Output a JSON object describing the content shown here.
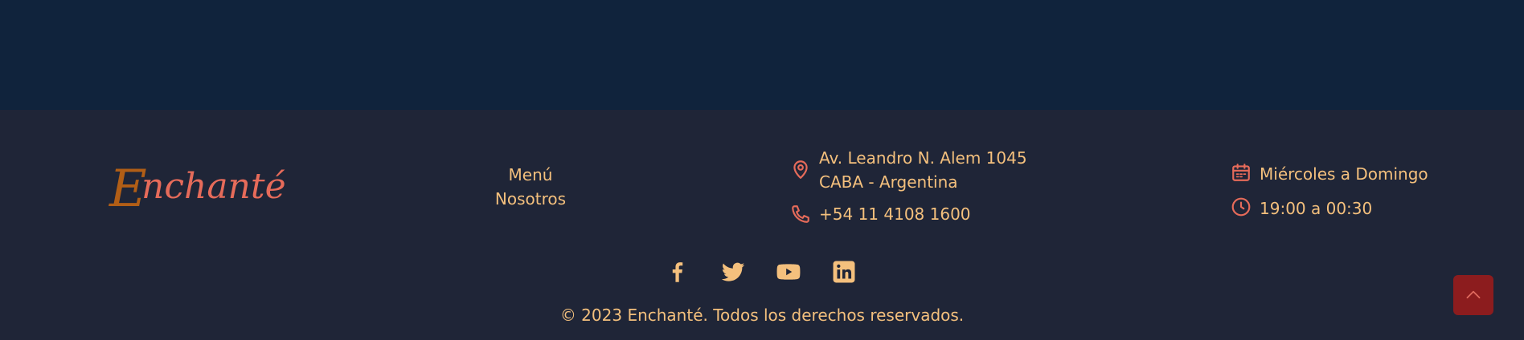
{
  "brand": {
    "logo_first": "E",
    "logo_rest": "nchanté"
  },
  "nav": {
    "items": [
      {
        "label": "Menú"
      },
      {
        "label": "Nosotros"
      }
    ]
  },
  "contact": {
    "address_line1": "Av. Leandro N. Alem 1045",
    "address_line2": "CABA - Argentina",
    "phone": "+54 11 4108 1600",
    "icons": {
      "address": "map-pin-icon",
      "phone": "phone-icon"
    }
  },
  "hours": {
    "days": "Miércoles a Domingo",
    "time": "19:00 a 00:30",
    "icons": {
      "days": "calendar-icon",
      "time": "clock-icon"
    }
  },
  "social": [
    {
      "icon": "facebook-icon"
    },
    {
      "icon": "twitter-icon"
    },
    {
      "icon": "youtube-icon"
    },
    {
      "icon": "linkedin-icon"
    }
  ],
  "copyright": "© 2023 Enchanté. Todos los derechos reservados.",
  "back_to_top": {
    "icon": "chevron-up-icon"
  },
  "colors": {
    "top_band": "#10233c",
    "footer_bg": "#1f2537",
    "text_accent": "#f4c07d",
    "icon_accent": "#e66b5a",
    "logo_brown": "#b15e16",
    "button_red": "#8c1c1e"
  }
}
